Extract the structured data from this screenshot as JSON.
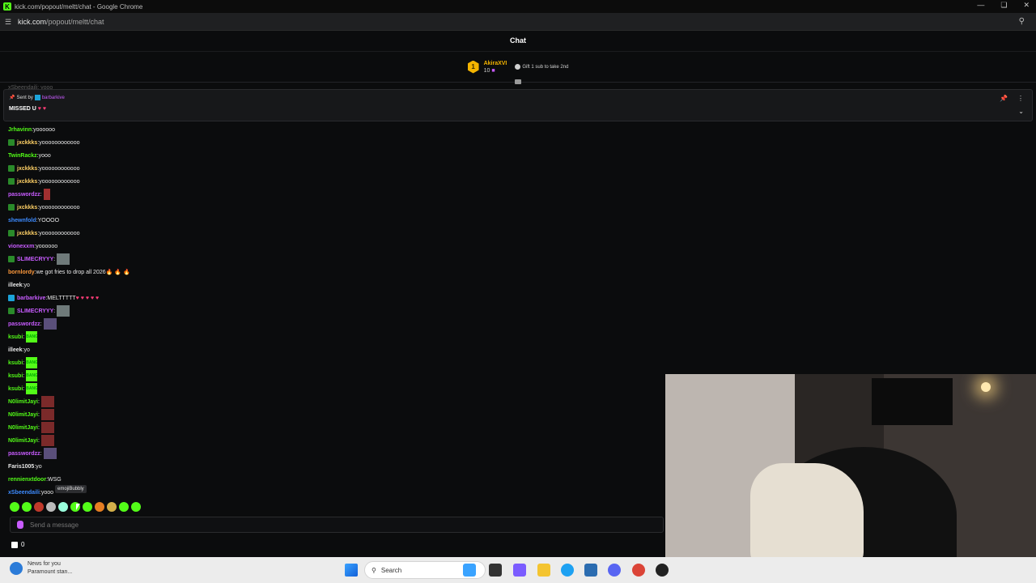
{
  "window": {
    "title": "kick.com/popout/meltt/chat - Google Chrome",
    "url_host": "kick.com",
    "url_path": "/popout/meltt/chat"
  },
  "chat": {
    "header": "Chat",
    "leader": {
      "rank": "1",
      "name": "AkiraXVI",
      "count": "10",
      "gift_text": "Gift 1 sub to take 2nd"
    },
    "ghost_row": "xSbeendaili: yooo",
    "pinned": {
      "sent_by_label": "Sent by",
      "sent_by_user": "barbarkive",
      "message": "MISSED U",
      "hearts": "♥ ♥"
    },
    "messages": [
      {
        "user": "Jrhavinn",
        "color": "#53fc18",
        "badge": "",
        "text": "yoooooo",
        "extra": ""
      },
      {
        "user": "jxckkks",
        "color": "#ffd166",
        "badge": "green",
        "text": "yoooooooooooo",
        "extra": ""
      },
      {
        "user": "TwinRackz",
        "color": "#53fc18",
        "badge": "",
        "text": "yooo",
        "extra": ""
      },
      {
        "user": "jxckkks",
        "color": "#ffd166",
        "badge": "green",
        "text": "yoooooooooooo",
        "extra": ""
      },
      {
        "user": "jxckkks",
        "color": "#ffd166",
        "badge": "green",
        "text": "yoooooooooooo",
        "extra": ""
      },
      {
        "user": "passwordzz",
        "color": "#c85cff",
        "badge": "",
        "text": "",
        "extra": "red"
      },
      {
        "user": "jxckkks",
        "color": "#ffd166",
        "badge": "green",
        "text": "yoooooooooooo",
        "extra": ""
      },
      {
        "user": "shewnfold",
        "color": "#3d8bff",
        "badge": "",
        "text": "YOOOO",
        "extra": ""
      },
      {
        "user": "jxckkks",
        "color": "#ffd166",
        "badge": "green",
        "text": "yoooooooooooo",
        "extra": ""
      },
      {
        "user": "vionexxm",
        "color": "#c85cff",
        "badge": "",
        "text": "yoooooo",
        "extra": ""
      },
      {
        "user": "SLIMECRYYY",
        "color": "#c85cff",
        "badge": "green",
        "text": "",
        "extra": "gray"
      },
      {
        "user": "bornlordy",
        "color": "#ff9a3d",
        "badge": "",
        "text": "we got fries to drop all 2026",
        "extra": "fire"
      },
      {
        "user": "illeek",
        "color": "#e8e8e8",
        "badge": "",
        "text": "yo",
        "extra": ""
      },
      {
        "user": "barbarkive",
        "color": "#c85cff",
        "badge": "blue",
        "text": "MELTTTTT",
        "extra": "hearts"
      },
      {
        "user": "SLIMECRYYY",
        "color": "#c85cff",
        "badge": "green",
        "text": "",
        "extra": "gray"
      },
      {
        "user": "passwordzz",
        "color": "#c85cff",
        "badge": "",
        "text": "",
        "extra": "purple"
      },
      {
        "user": "ksubi",
        "color": "#53fc18",
        "badge": "",
        "text": "",
        "extra": "bang"
      },
      {
        "user": "illeek",
        "color": "#e8e8e8",
        "badge": "",
        "text": "yo",
        "extra": ""
      },
      {
        "user": "ksubi",
        "color": "#53fc18",
        "badge": "",
        "text": "",
        "extra": "bang"
      },
      {
        "user": "ksubi",
        "color": "#53fc18",
        "badge": "",
        "text": "",
        "extra": "bang"
      },
      {
        "user": "ksubi",
        "color": "#53fc18",
        "badge": "",
        "text": "",
        "extra": "bang"
      },
      {
        "user": "N0limitJayi",
        "color": "#53fc18",
        "badge": "",
        "text": "",
        "extra": "face"
      },
      {
        "user": "N0limitJayi",
        "color": "#53fc18",
        "badge": "",
        "text": "",
        "extra": "face"
      },
      {
        "user": "N0limitJayi",
        "color": "#53fc18",
        "badge": "",
        "text": "",
        "extra": "face"
      },
      {
        "user": "N0limitJayi",
        "color": "#53fc18",
        "badge": "",
        "text": "",
        "extra": "face"
      },
      {
        "user": "passwordzz",
        "color": "#c85cff",
        "badge": "",
        "text": "",
        "extra": "purple"
      },
      {
        "user": "Faris1005",
        "color": "#e8e8e8",
        "badge": "",
        "text": "yo",
        "extra": ""
      },
      {
        "user": "rennienxtdoor",
        "color": "#53fc18",
        "badge": "",
        "text": "WSG",
        "extra": ""
      },
      {
        "user": "xSbeendaili",
        "color": "#3d8bff",
        "badge": "",
        "text": "yooo",
        "extra": ""
      }
    ],
    "tooltip": "emojiBubbly",
    "input_placeholder": "Send a message",
    "points": "0",
    "bang_text": "BANG"
  },
  "taskbar": {
    "news_title": "News for you",
    "news_sub": "Paramount stan...",
    "search_placeholder": "Search"
  },
  "colors": {
    "kick_green": "#53fc18",
    "heart": "#ff3d77"
  }
}
